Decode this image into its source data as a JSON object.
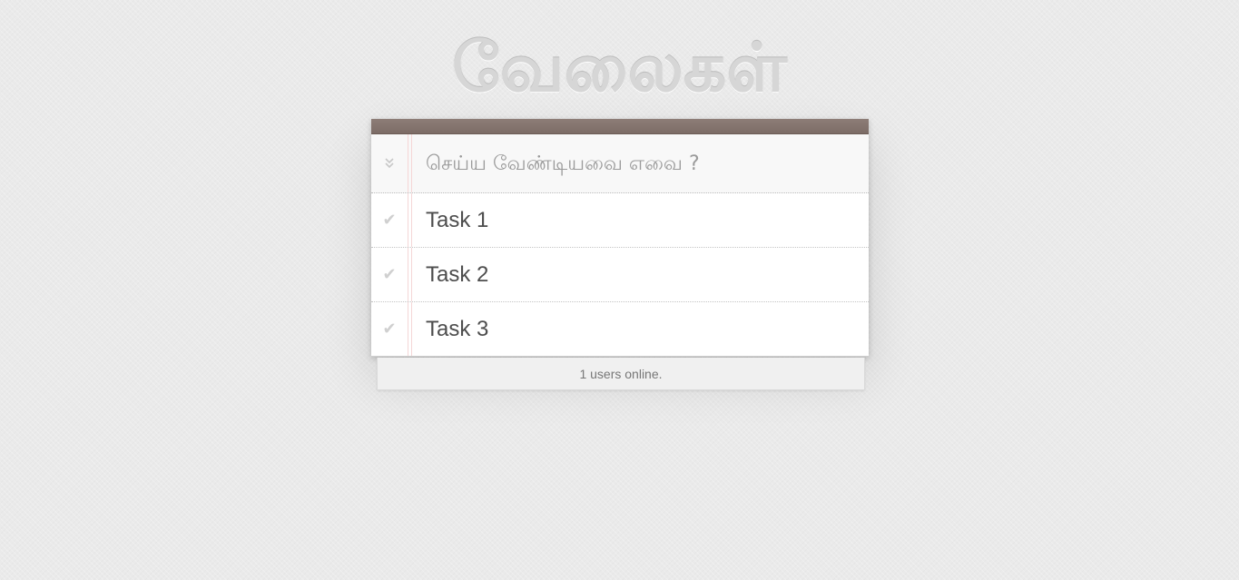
{
  "header": {
    "title": "வேலைகள்"
  },
  "new_todo": {
    "placeholder": "செய்ய வேண்டியவை எவை ?",
    "value": ""
  },
  "todos": [
    {
      "label": "Task 1",
      "completed": false
    },
    {
      "label": "Task 2",
      "completed": false
    },
    {
      "label": "Task 3",
      "completed": false
    }
  ],
  "icons": {
    "toggle_all": "double-chevron-down-icon",
    "check": "checkmark-icon"
  },
  "footer": {
    "status": "1 users online."
  },
  "colors": {
    "top_bar": "#8d7d77",
    "title": "#d6d6d6",
    "margin_line": "#f5d6d6",
    "text": "#4d4d4d",
    "background": "#eaeaea"
  }
}
